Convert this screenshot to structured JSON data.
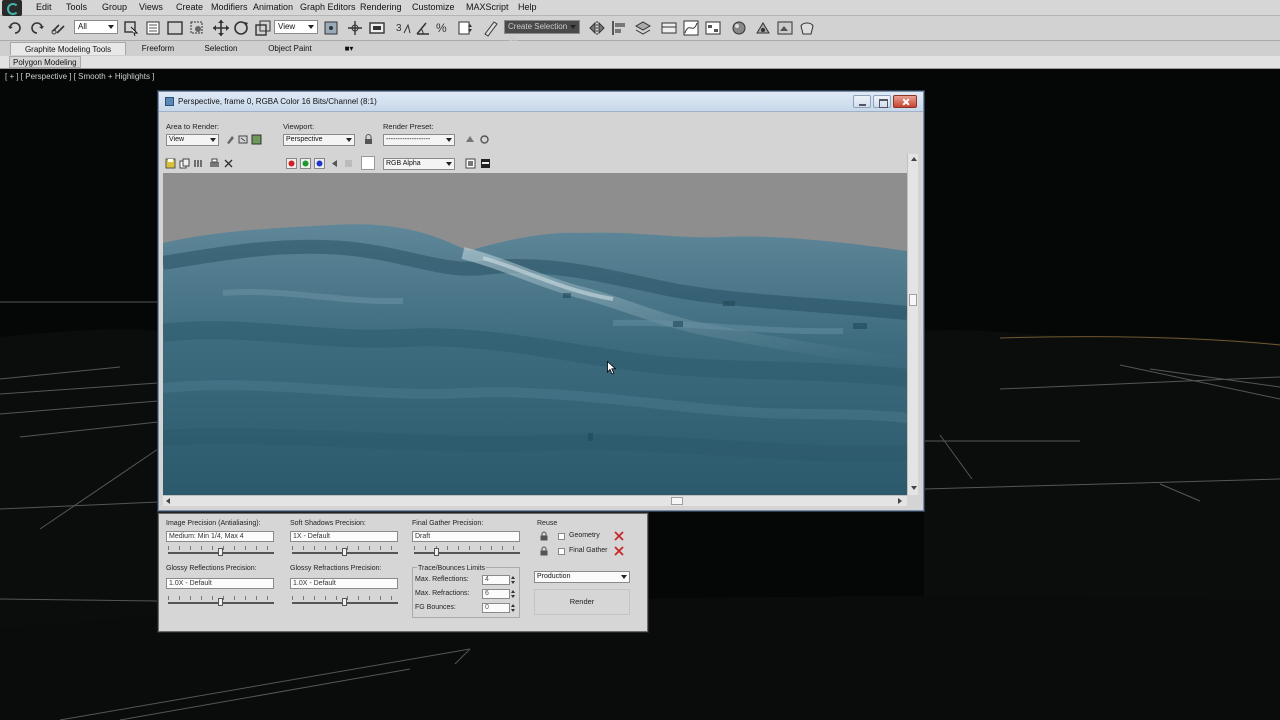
{
  "menu": {
    "items": [
      "Edit",
      "Tools",
      "Group",
      "Views",
      "Create",
      "Modifiers",
      "Animation",
      "Graph Editors",
      "Rendering",
      "Customize",
      "MAXScript",
      "Help"
    ]
  },
  "toolbar": {
    "selection_filter": "All",
    "reference_coord": "View",
    "named_selection_placeholder": "Create Selection Se"
  },
  "ribbon": {
    "tabs": [
      "Graphite Modeling Tools",
      "Freeform",
      "Selection",
      "Object Paint"
    ],
    "active_tab": "Graphite Modeling Tools",
    "panel_label": "Polygon Modeling"
  },
  "viewport": {
    "label": "[ + ] [ Perspective ] [ Smooth + Highlights ]"
  },
  "render_window": {
    "title": "Perspective, frame 0, RGBA Color 16 Bits/Channel (8:1)",
    "area_to_render_label": "Area to Render:",
    "area_to_render_value": "View",
    "viewport_label": "Viewport:",
    "viewport_value": "Perspective",
    "render_preset_label": "Render Preset:",
    "render_preset_value": "-------------------",
    "channel_value": "RGB Alpha"
  },
  "settings": {
    "image_precision_label": "Image Precision (Antialiasing):",
    "image_precision_value": "Medium: Min 1/4, Max 4",
    "soft_shadows_label": "Soft Shadows Precision:",
    "soft_shadows_value": "1X - Default",
    "final_gather_label": "Final Gather Precision:",
    "final_gather_value": "Draft",
    "reuse_label": "Reuse",
    "geometry_label": "Geometry",
    "final_gather_reuse_label": "Final Gather",
    "glossy_reflections_label": "Glossy Reflections Precision:",
    "glossy_reflections_value": "1.0X - Default",
    "glossy_refractions_label": "Glossy Refractions Precision:",
    "glossy_refractions_value": "1.0X - Default",
    "trace_bounces_label": "Trace/Bounces Limits",
    "max_reflections_label": "Max. Reflections:",
    "max_reflections_value": "4",
    "max_refractions_label": "Max. Refractions:",
    "max_refractions_value": "6",
    "fg_bounces_label": "FG Bounces:",
    "fg_bounces_value": "0",
    "production_value": "Production",
    "render_button": "Render"
  },
  "colors": {
    "menubar_bg": "#d6d6d6",
    "viewport_bg": "#050606",
    "sea_deep": "#2f5f73",
    "sea_light": "#8cb0bf",
    "sky": "#8e8e8e",
    "close_button": "#c7432f"
  }
}
